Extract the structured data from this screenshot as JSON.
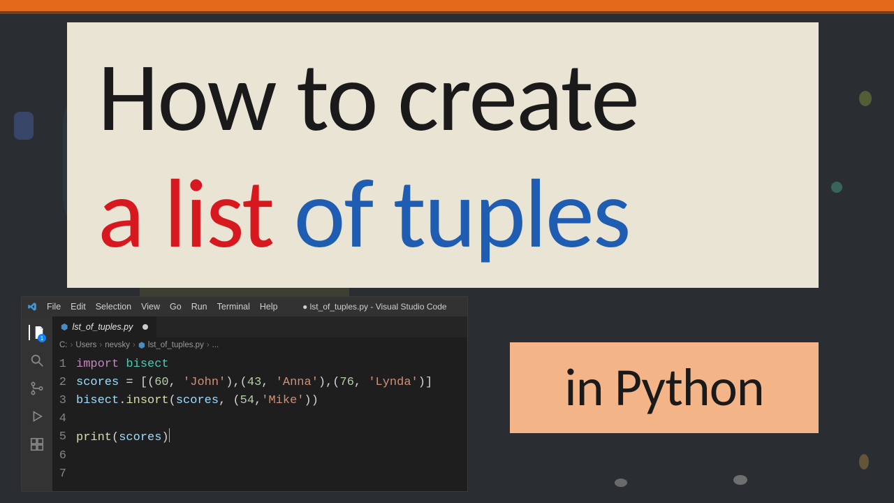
{
  "overlay": {
    "title_line1": "How to create",
    "title_line2_red": "a list",
    "title_line2_blue": " of tuples",
    "lang_label": "in Python"
  },
  "vscode": {
    "menubar": [
      "File",
      "Edit",
      "Selection",
      "View",
      "Go",
      "Run",
      "Terminal",
      "Help"
    ],
    "window_title": "● lst_of_tuples.py - Visual Studio Code",
    "tab": {
      "filename": "lst_of_tuples.py",
      "modified": true
    },
    "breadcrumb": [
      "C:",
      "Users",
      "nevsky",
      "lst_of_tuples.py",
      "..."
    ],
    "activity": {
      "explorer_badge": "1"
    },
    "code_lines": {
      "l1_kw": "import",
      "l1_mod": " bisect",
      "l2_var": "scores",
      "l2_assign": " = [(",
      "l2_n1": "60",
      "l2_c": ", ",
      "l2_s1": "'John'",
      "l2_m": "),(",
      "l2_n2": "43",
      "l2_s2": "'Anna'",
      "l2_n3": "76",
      "l2_s3": "'Lynda'",
      "l2_end": ")]",
      "l3_obj": "bisect",
      "l3_dot": ".",
      "l3_fn": "insort",
      "l3_open": "(",
      "l3_arg1": "scores",
      "l3_sep": ", (",
      "l3_n": "54",
      "l3_s": "'Mike'",
      "l3_close": "))",
      "l5_fn": "print",
      "l5_open": "(",
      "l5_arg": "scores",
      "l5_close": ")"
    },
    "line_numbers": [
      "1",
      "2",
      "3",
      "4",
      "5",
      "6",
      "7"
    ]
  }
}
